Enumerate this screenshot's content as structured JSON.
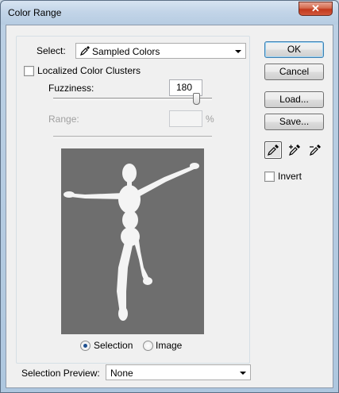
{
  "window": {
    "title": "Color Range",
    "close_glyph": "✕"
  },
  "select": {
    "label": "Select:",
    "value": "Sampled Colors",
    "icon": "eyedropper-icon"
  },
  "localized_clusters": {
    "label": "Localized Color Clusters",
    "checked": false
  },
  "fuzziness": {
    "label": "Fuzziness:",
    "value": "180",
    "slider_fraction": 0.9
  },
  "range": {
    "label": "Range:",
    "value": "",
    "unit": "%"
  },
  "buttons": {
    "ok": "OK",
    "cancel": "Cancel",
    "load": "Load...",
    "save": "Save..."
  },
  "tools": [
    "eyedropper-icon",
    "eyedropper-plus-icon",
    "eyedropper-minus-icon"
  ],
  "invert": {
    "label": "Invert",
    "checked": false
  },
  "preview_mode": {
    "selection_label": "Selection",
    "image_label": "Image",
    "selected": "Selection"
  },
  "selection_preview": {
    "label": "Selection Preview:",
    "value": "None"
  },
  "colors": {
    "preview_bg": "#6e6e6e",
    "figure": "#f4f4f4",
    "accent": "#3c7fb1"
  }
}
